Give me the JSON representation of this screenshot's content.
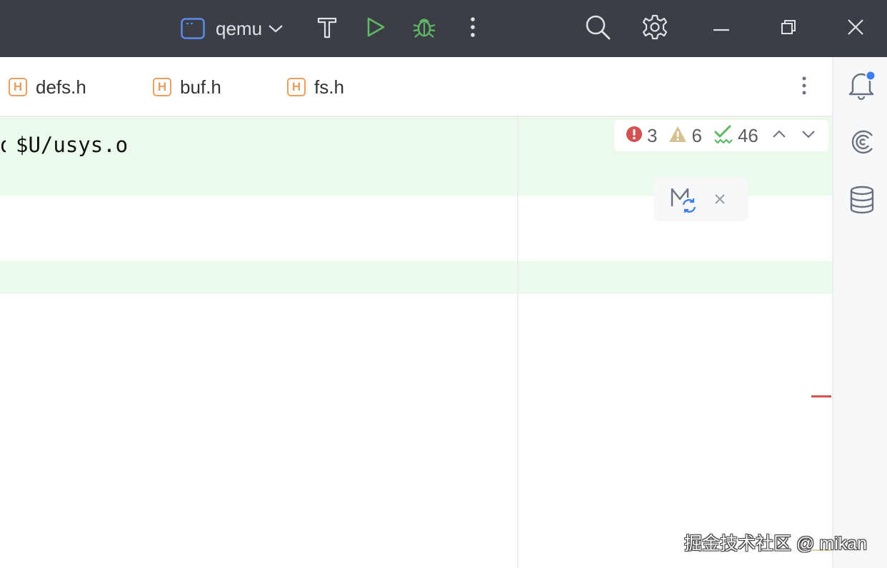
{
  "titlebar": {
    "run_config": "qemu",
    "icons": [
      "terminal-window-icon",
      "chevron-down-icon",
      "hammer-icon",
      "run-icon",
      "debug-bug-icon",
      "more-vertical-icon",
      "search-icon",
      "gear-icon",
      "minimize-icon",
      "restore-icon",
      "close-icon"
    ]
  },
  "tabs": [
    {
      "label": "defs.h",
      "icon_letter": "H"
    },
    {
      "label": "buf.h",
      "icon_letter": "H"
    },
    {
      "label": "fs.h",
      "icon_letter": "H"
    }
  ],
  "editor": {
    "visible_line": "$U/usys.o",
    "current_line_color": "#ebfaeb"
  },
  "inspections": {
    "errors": "3",
    "warnings": "6",
    "ok": "46"
  },
  "right_strip": {
    "icons": [
      "notifications-bell-icon",
      "ai-assistant-icon",
      "database-icon"
    ],
    "has_unread_notification": true
  },
  "watermark": "掘金技术社区 @ mikan",
  "colors": {
    "titlebar_bg": "#3b3e45",
    "run_green": "#5fb865",
    "error_red": "#d65252",
    "warning_tan": "#d4c18f",
    "accent_blue": "#3d7df0",
    "header_file_orange": "#e8a060"
  }
}
